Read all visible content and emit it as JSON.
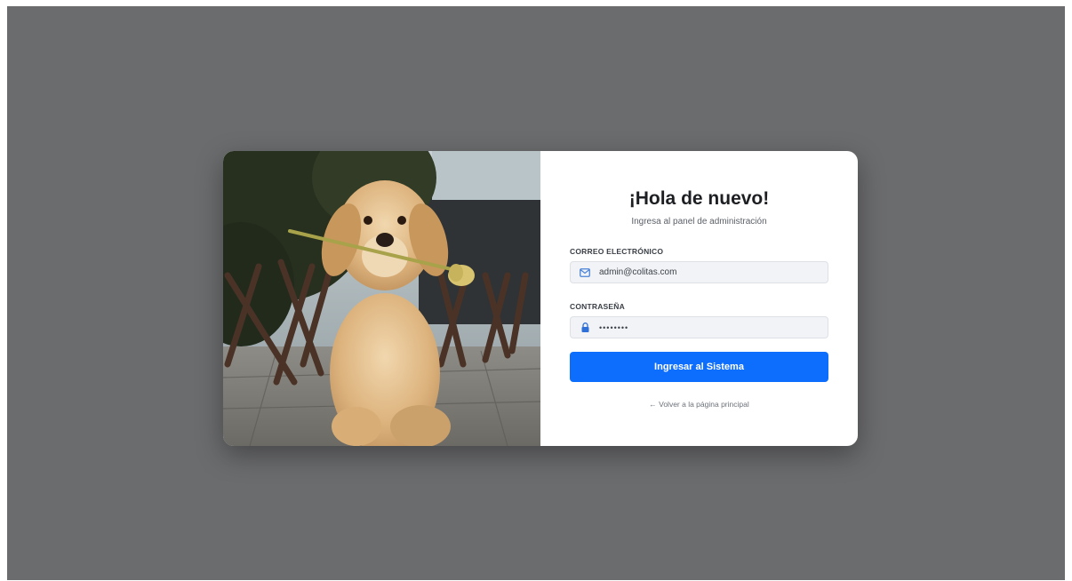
{
  "login": {
    "title": "¡Hola de nuevo!",
    "subtitle": "Ingresa al panel de administración",
    "email_label": "CORREO ELECTRÓNICO",
    "email_value": "admin@colitas.com",
    "password_label": "CONTRASEÑA",
    "password_value": "••••••••",
    "submit_label": "Ingresar al Sistema",
    "back_link": "← Volver a la página principal"
  },
  "colors": {
    "backdrop": "#6b6c6e",
    "primary": "#0d6efd",
    "card": "#ffffff"
  },
  "icons": {
    "email": "envelope-icon",
    "password": "lock-icon"
  }
}
